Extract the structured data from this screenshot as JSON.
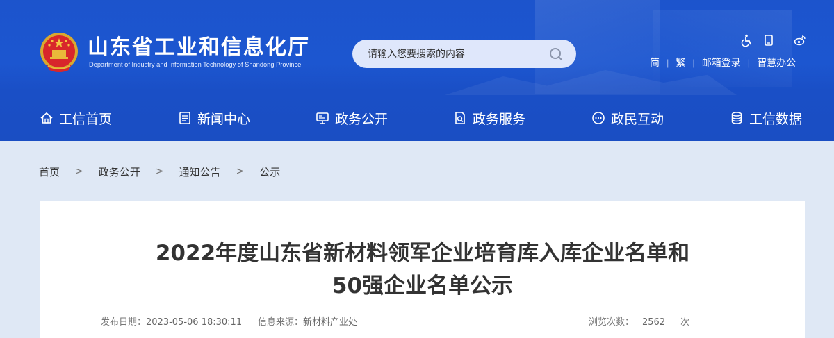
{
  "header": {
    "site_title": "山东省工业和信息化厅",
    "site_subtitle": "Department of Industry and Information Technology of Shandong Province",
    "search": {
      "placeholder": "请输入您要搜索的内容",
      "icon": "search-icon"
    },
    "top_icons": [
      "accessibility-icon",
      "mobile-icon",
      "weibo-icon"
    ],
    "top_links": {
      "simplified": "简",
      "traditional": "繁",
      "mail_login": "邮箱登录",
      "smart_office": "智慧办公"
    },
    "colors": {
      "header_blue": "#1d58d3",
      "page_bg": "#dfe8f5"
    }
  },
  "nav": {
    "items": [
      {
        "label": "工信首页",
        "icon": "home-icon"
      },
      {
        "label": "新闻中心",
        "icon": "document-icon"
      },
      {
        "label": "政务公开",
        "icon": "monitor-icon"
      },
      {
        "label": "政务服务",
        "icon": "service-icon"
      },
      {
        "label": "政民互动",
        "icon": "chat-icon"
      },
      {
        "label": "工信数据",
        "icon": "database-icon"
      }
    ]
  },
  "breadcrumb": {
    "items": [
      "首页",
      "政务公开",
      "通知公告",
      "公示"
    ],
    "separator": ">"
  },
  "article": {
    "title_line1": "2022年度山东省新材料领军企业培育库入库企业名单和",
    "title_line2": "50强企业名单公示",
    "publish_label": "发布日期：",
    "publish_value": "2023-05-06 18:30:11",
    "source_label": "信息来源：",
    "source_value": "新材料产业处",
    "views_label": "浏览次数：",
    "views_value": "2562",
    "views_unit": "次"
  }
}
